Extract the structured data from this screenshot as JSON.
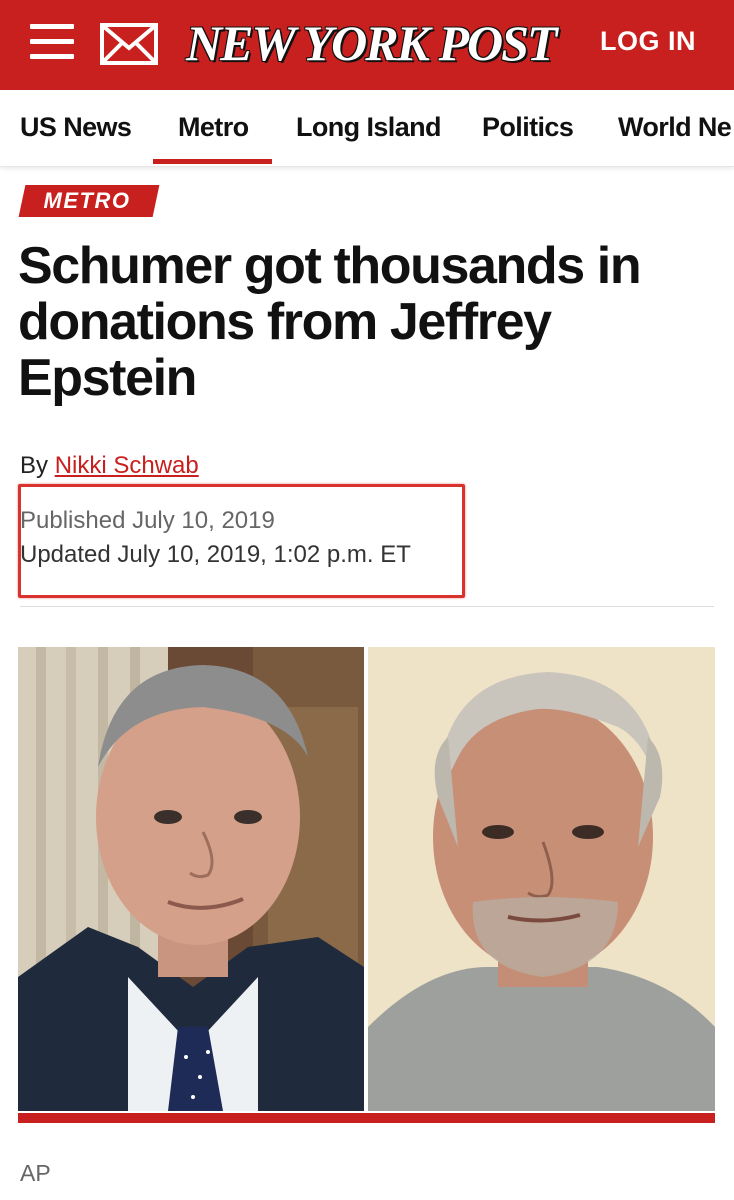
{
  "header": {
    "logo_text": "NEW YORK POST",
    "login_label": "LOG IN",
    "menu_icon": "hamburger-menu-icon",
    "mail_icon": "envelope-icon",
    "brand_color": "#c8201e"
  },
  "nav": {
    "items": [
      {
        "label": "US News",
        "active": false
      },
      {
        "label": "Metro",
        "active": true
      },
      {
        "label": "Long Island",
        "active": false
      },
      {
        "label": "Politics",
        "active": false
      },
      {
        "label": "World Ne",
        "active": false
      }
    ]
  },
  "article": {
    "section": "METRO",
    "headline": "Schumer got thousands in donations from Jeffrey Epstein",
    "byline_prefix": "By",
    "author": "Nikki Schwab",
    "published": "Published July 10, 2019",
    "updated": "Updated July 10, 2019, 1:02 p.m. ET",
    "photo_credit": "AP"
  }
}
